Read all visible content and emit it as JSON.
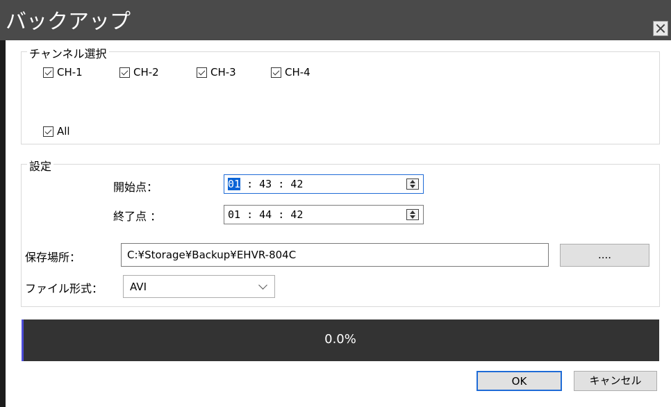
{
  "window": {
    "title": "バックアップ"
  },
  "channel_group": {
    "legend": "チャンネル選択",
    "channels": [
      {
        "label": "CH-1",
        "checked": true
      },
      {
        "label": "CH-2",
        "checked": true
      },
      {
        "label": "CH-3",
        "checked": true
      },
      {
        "label": "CH-4",
        "checked": true
      }
    ],
    "all": {
      "label": "All",
      "checked": true
    }
  },
  "settings_group": {
    "legend": "設定",
    "start": {
      "label": "開始点：",
      "hh": "01",
      "rest": " : 43 : 42"
    },
    "end": {
      "label": "終了点 ：",
      "value": "01 : 44 : 42"
    },
    "save_location": {
      "label": "保存場所：",
      "value": "C:¥Storage¥Backup¥EHVR-804C",
      "browse_label": "...."
    },
    "file_format": {
      "label": "ファイル形式：",
      "value": "AVI"
    }
  },
  "progress": {
    "percent": 0.0,
    "text": "0.0%"
  },
  "buttons": {
    "ok": "OK",
    "cancel": "キャンセル"
  },
  "colors": {
    "title_bar": "#4a4a4a",
    "progress_bg": "#333333",
    "progress_accent": "#4b4bd6",
    "focus_border": "#1e6bd6",
    "selection": "#0a64d6"
  }
}
